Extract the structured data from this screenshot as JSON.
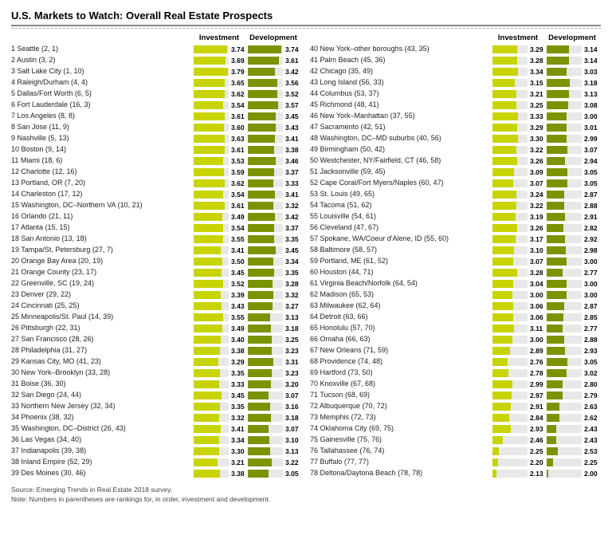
{
  "title": "U.S. Markets to Watch: Overall Real Estate Prospects",
  "headers": {
    "investment": "Investment",
    "development": "Development"
  },
  "colors": {
    "investment": "#c8d400",
    "development": "#8db000",
    "maxVal": 4.0,
    "minVal": 1.8
  },
  "left_rows": [
    {
      "rank": "1",
      "label": "Seattle (2, 1)",
      "inv": 3.74,
      "dev": 3.74
    },
    {
      "rank": "2",
      "label": "Austin (3, 2)",
      "inv": 3.69,
      "dev": 3.61
    },
    {
      "rank": "3",
      "label": "Salt Lake City (1, 10)",
      "inv": 3.79,
      "dev": 3.42
    },
    {
      "rank": "4",
      "label": "Raleigh/Durham (4, 4)",
      "inv": 3.65,
      "dev": 3.56
    },
    {
      "rank": "5",
      "label": "Dallas/Fort Worth (6, 5)",
      "inv": 3.62,
      "dev": 3.52
    },
    {
      "rank": "6",
      "label": "Fort Lauderdale (16, 3)",
      "inv": 3.54,
      "dev": 3.57
    },
    {
      "rank": "7",
      "label": "Los Angeles (8, 8)",
      "inv": 3.61,
      "dev": 3.45
    },
    {
      "rank": "8",
      "label": "San Jose (11, 9)",
      "inv": 3.6,
      "dev": 3.43
    },
    {
      "rank": "9",
      "label": "Nashville (5, 13)",
      "inv": 3.63,
      "dev": 3.41
    },
    {
      "rank": "10",
      "label": "Boston (9, 14)",
      "inv": 3.61,
      "dev": 3.38
    },
    {
      "rank": "11",
      "label": "Miami (18, 6)",
      "inv": 3.53,
      "dev": 3.46
    },
    {
      "rank": "12",
      "label": "Charlotte (12, 16)",
      "inv": 3.59,
      "dev": 3.37
    },
    {
      "rank": "13",
      "label": "Portland, OR (7, 20)",
      "inv": 3.62,
      "dev": 3.33
    },
    {
      "rank": "14",
      "label": "Charleston (17, 12)",
      "inv": 3.54,
      "dev": 3.41
    },
    {
      "rank": "15",
      "label": "Washington, DC–Northern VA (10, 21)",
      "inv": 3.61,
      "dev": 3.32
    },
    {
      "rank": "16",
      "label": "Orlando (21, 11)",
      "inv": 3.49,
      "dev": 3.42
    },
    {
      "rank": "17",
      "label": "Atlanta (15, 15)",
      "inv": 3.54,
      "dev": 3.37
    },
    {
      "rank": "18",
      "label": "San Antonio (13, 18)",
      "inv": 3.55,
      "dev": 3.35
    },
    {
      "rank": "19",
      "label": "Tampa/St. Petersburg (27, 7)",
      "inv": 3.41,
      "dev": 3.45
    },
    {
      "rank": "20",
      "label": "Orange Bay Area (20, 19)",
      "inv": 3.5,
      "dev": 3.34
    },
    {
      "rank": "21",
      "label": "Orange County (23, 17)",
      "inv": 3.45,
      "dev": 3.35
    },
    {
      "rank": "22",
      "label": "Greenville, SC (19, 24)",
      "inv": 3.52,
      "dev": 3.28
    },
    {
      "rank": "23",
      "label": "Denver (29, 22)",
      "inv": 3.39,
      "dev": 3.32
    },
    {
      "rank": "24",
      "label": "Cincinnati (25, 25)",
      "inv": 3.43,
      "dev": 3.27
    },
    {
      "rank": "25",
      "label": "Minneapolis/St. Paul (14, 39)",
      "inv": 3.55,
      "dev": 3.13
    },
    {
      "rank": "26",
      "label": "Pittsburgh (22, 31)",
      "inv": 3.49,
      "dev": 3.18
    },
    {
      "rank": "27",
      "label": "San Francisco (28, 26)",
      "inv": 3.4,
      "dev": 3.25
    },
    {
      "rank": "28",
      "label": "Philadelphia (31, 27)",
      "inv": 3.38,
      "dev": 3.23
    },
    {
      "rank": "29",
      "label": "Kansas City, MO (41, 23)",
      "inv": 3.29,
      "dev": 3.31
    },
    {
      "rank": "30",
      "label": "New York–Brooklyn (33, 28)",
      "inv": 3.35,
      "dev": 3.23
    },
    {
      "rank": "31",
      "label": "Boise (36, 30)",
      "inv": 3.33,
      "dev": 3.2
    },
    {
      "rank": "32",
      "label": "San Diego (24, 44)",
      "inv": 3.45,
      "dev": 3.07
    },
    {
      "rank": "33",
      "label": "Northern New Jersey (32, 34)",
      "inv": 3.35,
      "dev": 3.16
    },
    {
      "rank": "34",
      "label": "Phoenix (38, 32)",
      "inv": 3.32,
      "dev": 3.18
    },
    {
      "rank": "35",
      "label": "Washington, DC–District (26, 43)",
      "inv": 3.41,
      "dev": 3.07
    },
    {
      "rank": "36",
      "label": "Las Vegas (34, 40)",
      "inv": 3.34,
      "dev": 3.1
    },
    {
      "rank": "37",
      "label": "Indianapolis (39, 38)",
      "inv": 3.3,
      "dev": 3.13
    },
    {
      "rank": "38",
      "label": "Inland Empire (52, 29)",
      "inv": 3.21,
      "dev": 3.22
    },
    {
      "rank": "39",
      "label": "Des Moines (30, 46)",
      "inv": 3.38,
      "dev": 3.05
    }
  ],
  "right_rows": [
    {
      "rank": "40",
      "label": "New York–other boroughs (43, 35)",
      "inv": 3.29,
      "dev": 3.14
    },
    {
      "rank": "41",
      "label": "Palm Beach (45, 36)",
      "inv": 3.28,
      "dev": 3.14
    },
    {
      "rank": "42",
      "label": "Chicago (35, 49)",
      "inv": 3.34,
      "dev": 3.03
    },
    {
      "rank": "43",
      "label": "Long Island (56, 33)",
      "inv": 3.15,
      "dev": 3.18
    },
    {
      "rank": "44",
      "label": "Columbus (53, 37)",
      "inv": 3.21,
      "dev": 3.13
    },
    {
      "rank": "45",
      "label": "Richmond (48, 41)",
      "inv": 3.25,
      "dev": 3.08
    },
    {
      "rank": "46",
      "label": "New York–Manhattan (37, 55)",
      "inv": 3.33,
      "dev": 3.0
    },
    {
      "rank": "47",
      "label": "Sacramento (42, 51)",
      "inv": 3.29,
      "dev": 3.01
    },
    {
      "rank": "48",
      "label": "Washington, DC–MD suburbs (40, 56)",
      "inv": 3.3,
      "dev": 2.99
    },
    {
      "rank": "49",
      "label": "Birmingham (50, 42)",
      "inv": 3.22,
      "dev": 3.07
    },
    {
      "rank": "50",
      "label": "Westchester, NY/Fairfield, CT (46, 58)",
      "inv": 3.26,
      "dev": 2.94
    },
    {
      "rank": "51",
      "label": "Jacksonville (59, 45)",
      "inv": 3.09,
      "dev": 3.05
    },
    {
      "rank": "52",
      "label": "Cape Coral/Fort Myers/Naples (60, 47)",
      "inv": 3.07,
      "dev": 3.05
    },
    {
      "rank": "53",
      "label": "St. Louis (49, 65)",
      "inv": 3.24,
      "dev": 2.87
    },
    {
      "rank": "54",
      "label": "Tacoma (51, 62)",
      "inv": 3.22,
      "dev": 2.88
    },
    {
      "rank": "55",
      "label": "Louisville (54, 61)",
      "inv": 3.19,
      "dev": 2.91
    },
    {
      "rank": "56",
      "label": "Cleveland (47, 67)",
      "inv": 3.26,
      "dev": 2.82
    },
    {
      "rank": "57",
      "label": "Spokane, WA/Coeur d'Alene, ID (55, 60)",
      "inv": 3.17,
      "dev": 2.92
    },
    {
      "rank": "58",
      "label": "Baltimore (58, 57)",
      "inv": 3.1,
      "dev": 2.98
    },
    {
      "rank": "59",
      "label": "Portland, ME (61, 52)",
      "inv": 3.07,
      "dev": 3.0
    },
    {
      "rank": "60",
      "label": "Houston (44, 71)",
      "inv": 3.28,
      "dev": 2.77
    },
    {
      "rank": "61",
      "label": "Virginia Beach/Norfolk (64, 54)",
      "inv": 3.04,
      "dev": 3.0
    },
    {
      "rank": "62",
      "label": "Madison (65, 53)",
      "inv": 3.0,
      "dev": 3.0
    },
    {
      "rank": "63",
      "label": "Milwaukee (62, 64)",
      "inv": 3.06,
      "dev": 2.87
    },
    {
      "rank": "64",
      "label": "Detroit (63, 66)",
      "inv": 3.06,
      "dev": 2.85
    },
    {
      "rank": "65",
      "label": "Honolulu (57, 70)",
      "inv": 3.11,
      "dev": 2.77
    },
    {
      "rank": "66",
      "label": "Omaha (66, 63)",
      "inv": 3.0,
      "dev": 2.88
    },
    {
      "rank": "67",
      "label": "New Orleans (71, 59)",
      "inv": 2.89,
      "dev": 2.93
    },
    {
      "rank": "68",
      "label": "Providence (74, 48)",
      "inv": 2.76,
      "dev": 3.05
    },
    {
      "rank": "69",
      "label": "Hartford (73, 50)",
      "inv": 2.78,
      "dev": 3.02
    },
    {
      "rank": "70",
      "label": "Knoxville (67, 68)",
      "inv": 2.99,
      "dev": 2.8
    },
    {
      "rank": "71",
      "label": "Tucson (68, 69)",
      "inv": 2.97,
      "dev": 2.79
    },
    {
      "rank": "72",
      "label": "Albuquerque (70, 72)",
      "inv": 2.91,
      "dev": 2.63
    },
    {
      "rank": "73",
      "label": "Memphis (72, 73)",
      "inv": 2.84,
      "dev": 2.62
    },
    {
      "rank": "74",
      "label": "Oklahoma City (69, 75)",
      "inv": 2.93,
      "dev": 2.43
    },
    {
      "rank": "75",
      "label": "Gainesville (75, 76)",
      "inv": 2.46,
      "dev": 2.43
    },
    {
      "rank": "76",
      "label": "Tallahassee (76, 74)",
      "inv": 2.25,
      "dev": 2.53
    },
    {
      "rank": "77",
      "label": "Buffalo (77, 77)",
      "inv": 2.2,
      "dev": 2.25
    },
    {
      "rank": "78",
      "label": "Deltona/Daytona Beach (78, 78)",
      "inv": 2.13,
      "dev": 2.0
    }
  ],
  "footer": {
    "source": "Source: Emerging Trends in Real Estate 2018 survey.",
    "note": "Note: Numbers in parentheses are rankings for, in order, investment and development."
  }
}
